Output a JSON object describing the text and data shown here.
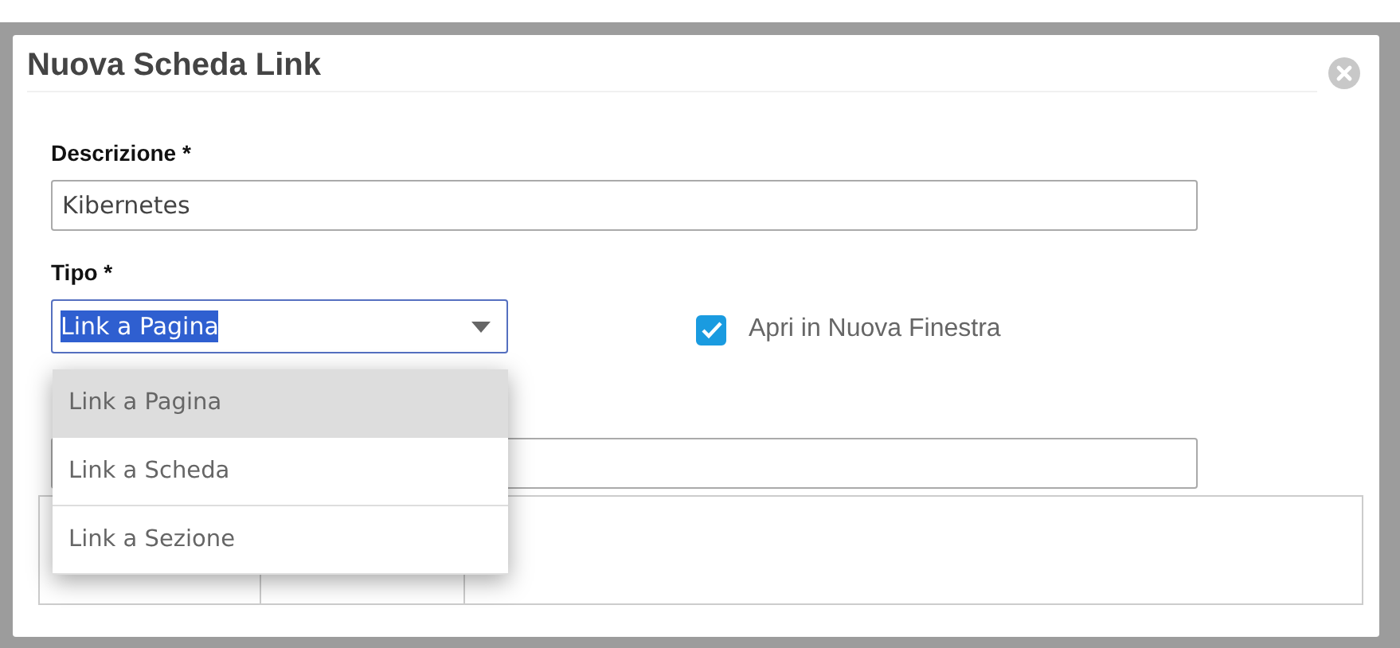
{
  "dialog": {
    "title": "Nuova Scheda Link"
  },
  "fields": {
    "descrizione": {
      "label": "Descrizione *",
      "value": "Kibernetes"
    },
    "tipo": {
      "label": "Tipo *",
      "value": "Link a Pagina",
      "expanded": true,
      "options": [
        {
          "label": "Link a Pagina",
          "selected": true
        },
        {
          "label": "Link a Scheda",
          "selected": false
        },
        {
          "label": "Link a Sezione",
          "selected": false
        }
      ]
    },
    "nuova_finestra": {
      "label": "Apri in Nuova Finestra",
      "checked": true
    }
  }
}
